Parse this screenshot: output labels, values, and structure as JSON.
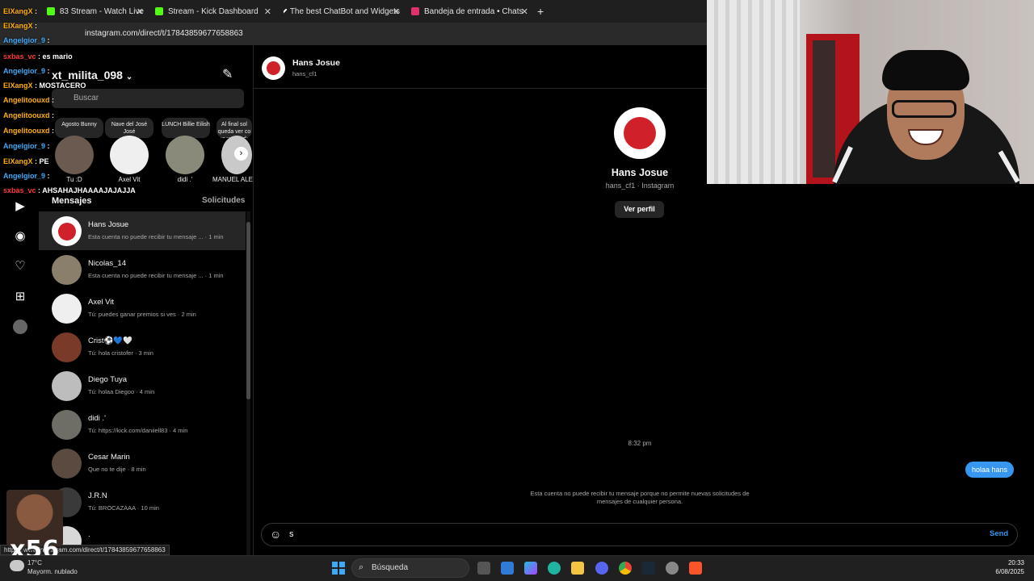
{
  "browser": {
    "tabs": [
      {
        "label": "83 Stream - Watch Live",
        "color": "#53fc18"
      },
      {
        "label": "Stream - Kick Dashboard",
        "color": "#53fc18"
      },
      {
        "label": "The best ChatBot and Widgets",
        "color": "#ffffff"
      },
      {
        "label": "Bandeja de entrada • Chats",
        "color": "#e1306c"
      }
    ],
    "new_tab": "+",
    "url": "instagram.com/direct/t/17843859677658863",
    "status_url": "https://www.instagram.com/direct/t/17843859677658863"
  },
  "sidebar": {
    "username": "xt_milita_098",
    "search_placeholder": "Buscar",
    "notes": [
      {
        "text": "Agosto Bunny"
      },
      {
        "text": "Nave del José José"
      },
      {
        "text": "LUNCH Billie Eilish"
      },
      {
        "text": "Al final sol queda ver co se va sin de"
      }
    ],
    "stories": [
      {
        "name": "Tu :D"
      },
      {
        "name": "Axel Vit"
      },
      {
        "name": "didi .'"
      },
      {
        "name": "MANUEL ALE"
      }
    ],
    "messages_heading": "Mensajes",
    "requests_heading": "Solicitudes",
    "conversations": [
      {
        "name": "Hans Josue",
        "preview": "Esta cuenta no puede recibir tu mensaje ... · 1 min"
      },
      {
        "name": "Nicolas_14",
        "preview": "Esta cuenta no puede recibir tu mensaje ... · 1 min"
      },
      {
        "name": "Axel Vit",
        "preview": "Tú: puedes ganar premios si ves · 2 min"
      },
      {
        "name": "Crist⚽💙🤍",
        "preview": "Tú: hola cristofer · 3 min"
      },
      {
        "name": "Diego Tuya",
        "preview": "Tú: holaa Diegoo · 4 min"
      },
      {
        "name": "didi .'",
        "preview": "Tú: https://kick.com/daniiell83 · 4 min"
      },
      {
        "name": "Cesar Marin",
        "preview": "Que no te dije · 8 min"
      },
      {
        "name": "J.R.N",
        "preview": "Tú: BROCAZAAA · 10 min"
      },
      {
        "name": ".",
        "preview": ""
      }
    ]
  },
  "chat": {
    "header_name": "Hans Josue",
    "header_handle": "hans_cf1",
    "profile_name": "Hans Josue",
    "profile_sub": "hans_cf1 · Instagram",
    "view_profile": "Ver perfil",
    "timestamp": "8:32 pm",
    "sent_message": "holaa hans",
    "error_text": "Esta cuenta no puede recibir tu mensaje porque no permite nuevas solicitudes de mensajes de cualquier persona.",
    "input_value": "s",
    "send_label": "Send"
  },
  "stream_overlay": {
    "lines": [
      {
        "user": "ElXangX",
        "msg": "",
        "color": "#ffb000"
      },
      {
        "user": "ElXangX",
        "msg": "",
        "color": "#ffb000"
      },
      {
        "user": "Angelgior_9",
        "msg": "",
        "color": "#3fa9f5"
      },
      {
        "user": "sxbas_vc",
        "msg": "es mario",
        "color": "#ff3b3b"
      },
      {
        "user": "Angelgior_9",
        "msg": "",
        "color": "#3fa9f5"
      },
      {
        "user": "ElXangX",
        "msg": "MOSTACERO",
        "color": "#ffb000"
      },
      {
        "user": "Angelitoouxd",
        "msg": "",
        "color": "#ffb000"
      },
      {
        "user": "Angelitoouxd",
        "msg": "",
        "color": "#ffb000"
      },
      {
        "user": "Angelitoouxd",
        "msg": "",
        "color": "#ffb000"
      },
      {
        "user": "Angelgior_9",
        "msg": "",
        "color": "#3fa9f5"
      },
      {
        "user": "ElXangX",
        "msg": "PE",
        "color": "#ffb000"
      },
      {
        "user": "Angelgior_9",
        "msg": "",
        "color": "#3fa9f5"
      },
      {
        "user": "sxbas_vc",
        "msg": "AHSAHAJHAAAAJAJAJJA",
        "color": "#ff3b3b"
      }
    ],
    "emote_text": "x56"
  },
  "taskbar": {
    "weather_temp": "17°C",
    "weather_desc": "Mayorm. nublado",
    "search_label": "Búsqueda",
    "time": "20:33",
    "date": "6/08/2025"
  },
  "colors": {
    "accent": "#3797f0",
    "bg": "#000000",
    "panel": "#262626"
  }
}
